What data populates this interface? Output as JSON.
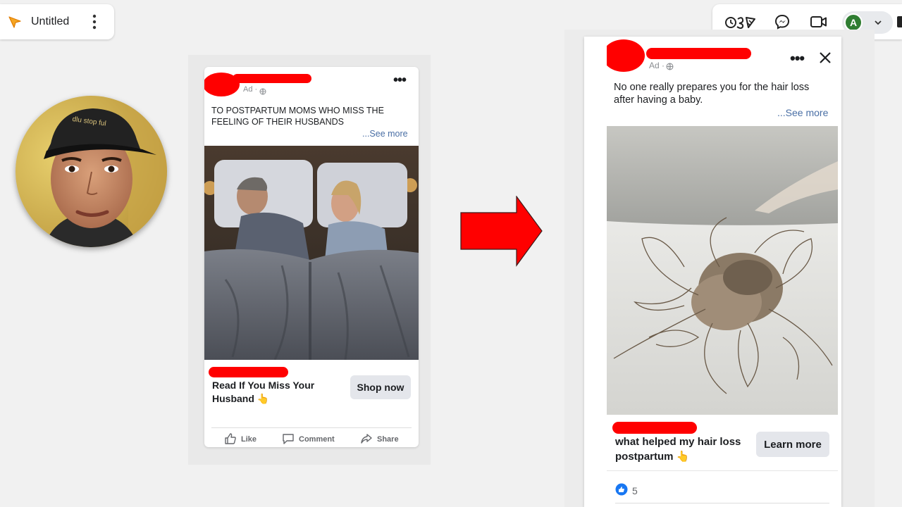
{
  "app": {
    "doc_title": "Untitled",
    "icons": [
      "cursor-icon",
      "kebab-icon"
    ]
  },
  "meet_bar": {
    "avatar_letter": "A",
    "icons": [
      "effects-icon",
      "messenger-icon",
      "video-camera-icon",
      "chevron-down-icon"
    ]
  },
  "ad_left": {
    "ad_label": "Ad ·",
    "headline": "TO POSTPARTUM MOMS WHO MISS THE FEELING OF THEIR HUSBANDS",
    "see_more": "...See more",
    "cta_title": "Read If You Miss Your Husband 👆",
    "cta_button": "Shop now",
    "actions": {
      "like": "Like",
      "comment": "Comment",
      "share": "Share"
    }
  },
  "ad_right": {
    "ad_label": "Ad ·",
    "headline": "No one really prepares you for the hair loss after having a baby.",
    "see_more": "...See more",
    "cta_title": "what helped my hair loss postpartum 👆",
    "cta_button": "Learn more",
    "reaction_count": "5"
  },
  "colors": {
    "redaction": "#ff0000",
    "arrow": "#ff0000",
    "link": "#4a6fa5",
    "button_bg": "#e4e6eb",
    "like_blue": "#1877f2",
    "avatar_green": "#2f7d32"
  }
}
